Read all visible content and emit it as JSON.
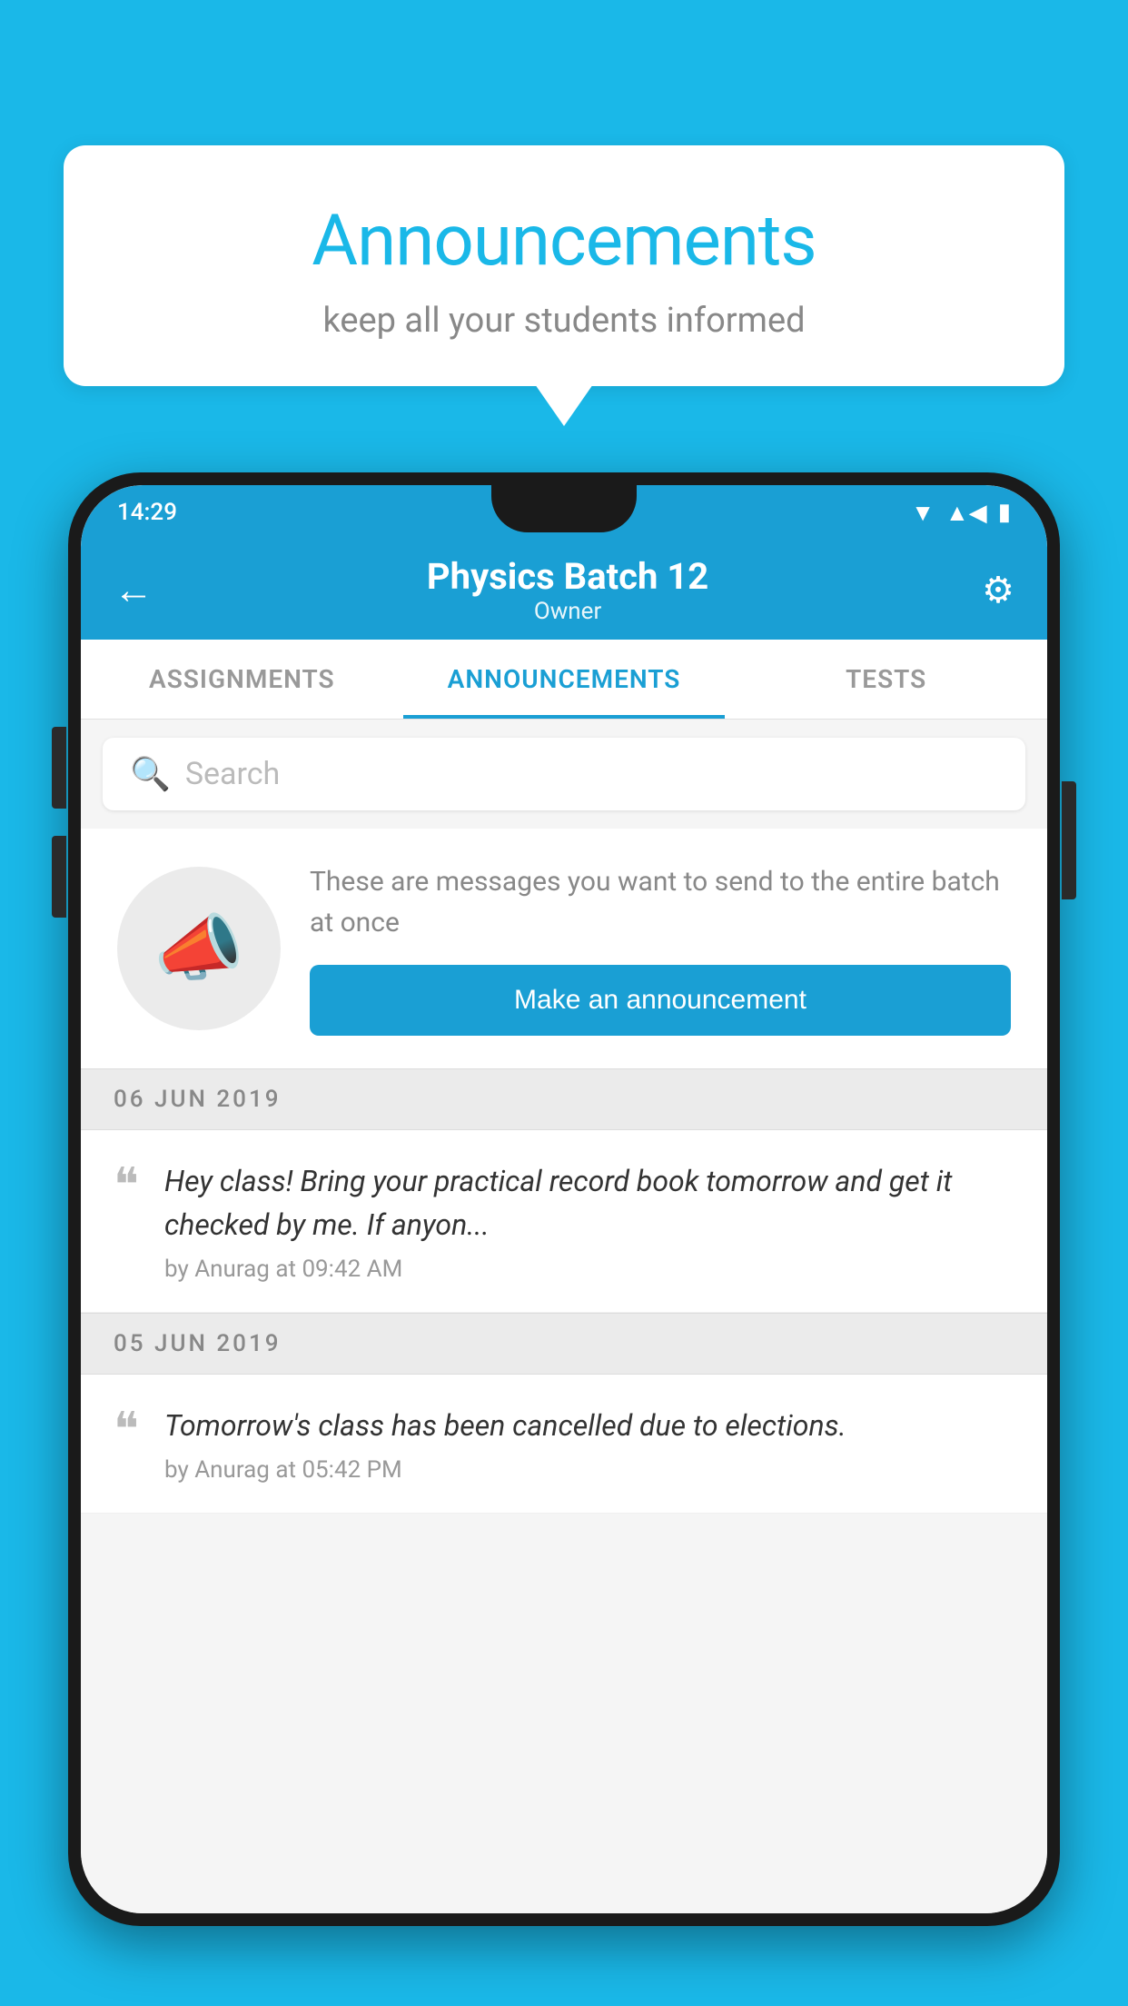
{
  "background_color": "#1ab8e8",
  "speech_bubble": {
    "title": "Announcements",
    "subtitle": "keep all your students informed"
  },
  "phone": {
    "status_bar": {
      "time": "14:29"
    },
    "app_bar": {
      "title": "Physics Batch 12",
      "subtitle": "Owner",
      "back_label": "←",
      "gear_label": "⚙"
    },
    "tabs": [
      {
        "label": "ASSIGNMENTS",
        "active": false
      },
      {
        "label": "ANNOUNCEMENTS",
        "active": true
      },
      {
        "label": "TESTS",
        "active": false
      }
    ],
    "search": {
      "placeholder": "Search"
    },
    "announcement_prompt": {
      "description": "These are messages you want to send to the entire batch at once",
      "button_label": "Make an announcement"
    },
    "date_groups": [
      {
        "date": "06  JUN  2019",
        "items": [
          {
            "text": "Hey class! Bring your practical record book tomorrow and get it checked by me. If anyon...",
            "meta": "by Anurag at 09:42 AM"
          }
        ]
      },
      {
        "date": "05  JUN  2019",
        "items": [
          {
            "text": "Tomorrow's class has been cancelled due to elections.",
            "meta": "by Anurag at 05:42 PM"
          }
        ]
      }
    ]
  }
}
